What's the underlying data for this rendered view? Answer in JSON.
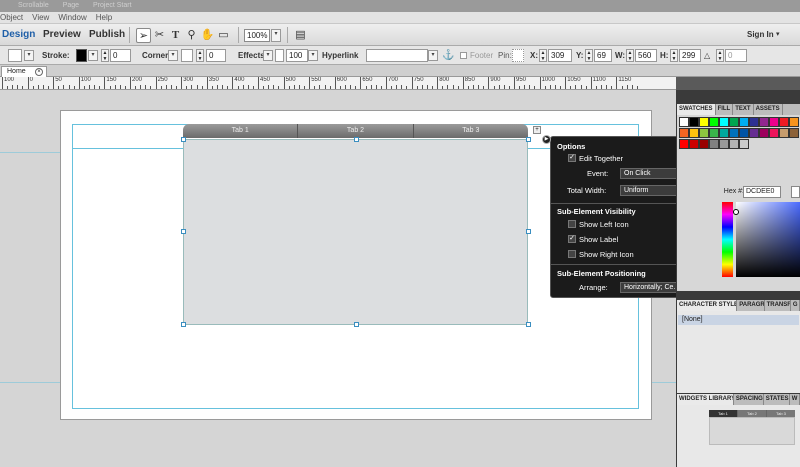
{
  "titlebar": {
    "items": [
      "Scrollable",
      "Page",
      "Project Start"
    ]
  },
  "menu": {
    "items": [
      "Object",
      "View",
      "Window",
      "Help"
    ]
  },
  "modes": {
    "design": "Design",
    "preview": "Preview",
    "publish": "Publish",
    "sign_in": "Sign In"
  },
  "toolbar": {
    "zoom": "100%"
  },
  "controls": {
    "stroke_label": "Stroke:",
    "stroke_value": "0",
    "corners_label": "Corners:",
    "corners_value": "0",
    "effects_label": "Effects:",
    "opacity_value": "100",
    "hyperlink_label": "Hyperlink",
    "footer_label": "Footer",
    "pin_label": "Pin:",
    "x_label": "X:",
    "x_value": "309",
    "y_label": "Y:",
    "y_value": "69",
    "w_label": "W:",
    "w_value": "560",
    "h_label": "H:",
    "h_value": "299",
    "rotation_value": "0"
  },
  "document": {
    "tab": "Home"
  },
  "ruler": {
    "labels": [
      "100",
      "0",
      "50",
      "100",
      "150",
      "200",
      "250",
      "300",
      "350",
      "400",
      "450",
      "500",
      "550",
      "600",
      "650",
      "700",
      "750",
      "800",
      "850",
      "900",
      "950",
      "1000",
      "1050",
      "1100",
      "1150"
    ]
  },
  "widget": {
    "tabs": [
      "Tab 1",
      "Tab 2",
      "Tab 3"
    ]
  },
  "options": {
    "title": "Options",
    "edit_together": "Edit Together",
    "event_label": "Event:",
    "event_value": "On Click",
    "width_label": "Total Width:",
    "width_value": "Uniform",
    "visibility_title": "Sub-Element Visibility",
    "show_left_icon": "Show Left Icon",
    "show_label": "Show Label",
    "show_right_icon": "Show Right Icon",
    "positioning_title": "Sub-Element Positioning",
    "arrange_label": "Arrange:",
    "arrange_value": "Horizontally; Ce..."
  },
  "panels": {
    "swatch_tabs": [
      "SWATCHES",
      "FILL",
      "TEXT",
      "ASSETS"
    ],
    "hex_label": "Hex #:",
    "hex_value": "DCDEE0",
    "char_tabs": [
      "CHARACTER STYLES",
      "PARAGR",
      "TRANSF",
      "G"
    ],
    "char_style": "[None]",
    "widget_tabs": [
      "WIDGETS LIBRARY",
      "SPACING",
      "STATES",
      "W"
    ],
    "thumb_tabs": [
      "Tab 1",
      "Tab 2",
      "Tab 3"
    ]
  },
  "colors": {
    "accent": "#1f5fa8",
    "widget_fill": "#DCDEE0",
    "guide": "#66c1dd"
  }
}
